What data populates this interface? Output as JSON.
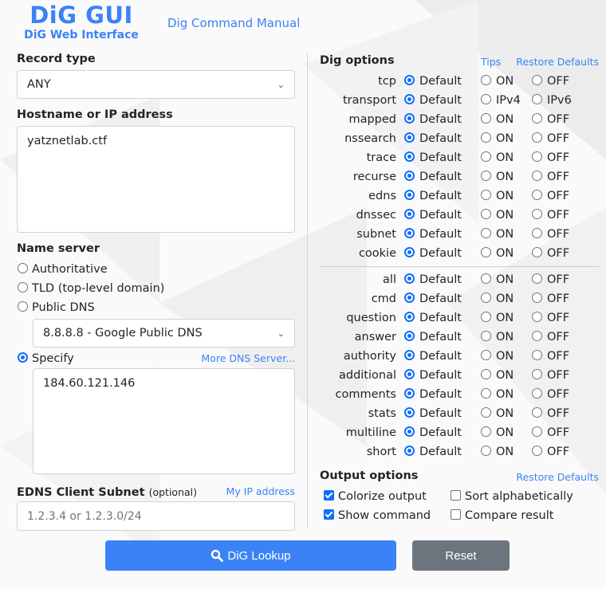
{
  "brand": {
    "title": "DiG GUI",
    "subtitle": "DiG Web Interface"
  },
  "header": {
    "manual_link": "Dig Command Manual"
  },
  "record_type": {
    "label": "Record type",
    "value": "ANY"
  },
  "hostname": {
    "label": "Hostname or IP address",
    "value": "yatznetlab.ctf"
  },
  "name_server": {
    "label": "Name server",
    "options": [
      {
        "label": "Authoritative",
        "checked": false
      },
      {
        "label": "TLD (top-level domain)",
        "checked": false
      },
      {
        "label": "Public DNS",
        "checked": false
      }
    ],
    "public_dns_value": "8.8.8.8 - Google Public DNS",
    "specify_label": "Specify",
    "specify_checked": true,
    "more_link": "More DNS Server...",
    "specify_value": "184.60.121.146"
  },
  "edns": {
    "label": "EDNS Client Subnet",
    "optional": "(optional)",
    "my_ip_link": "My IP address",
    "placeholder": "1.2.3.4 or 1.2.3.0/24"
  },
  "dig_options": {
    "label": "Dig options",
    "tips_link": "Tips",
    "restore_link": "Restore Defaults",
    "group1": [
      {
        "name": "tcp",
        "o1": "Default",
        "o2": "ON",
        "o3": "OFF"
      },
      {
        "name": "transport",
        "o1": "Default",
        "o2": "IPv4",
        "o3": "IPv6"
      },
      {
        "name": "mapped",
        "o1": "Default",
        "o2": "ON",
        "o3": "OFF"
      },
      {
        "name": "nssearch",
        "o1": "Default",
        "o2": "ON",
        "o3": "OFF"
      },
      {
        "name": "trace",
        "o1": "Default",
        "o2": "ON",
        "o3": "OFF"
      },
      {
        "name": "recurse",
        "o1": "Default",
        "o2": "ON",
        "o3": "OFF"
      },
      {
        "name": "edns",
        "o1": "Default",
        "o2": "ON",
        "o3": "OFF"
      },
      {
        "name": "dnssec",
        "o1": "Default",
        "o2": "ON",
        "o3": "OFF"
      },
      {
        "name": "subnet",
        "o1": "Default",
        "o2": "ON",
        "o3": "OFF"
      },
      {
        "name": "cookie",
        "o1": "Default",
        "o2": "ON",
        "o3": "OFF"
      }
    ],
    "group2": [
      {
        "name": "all",
        "o1": "Default",
        "o2": "ON",
        "o3": "OFF"
      },
      {
        "name": "cmd",
        "o1": "Default",
        "o2": "ON",
        "o3": "OFF"
      },
      {
        "name": "question",
        "o1": "Default",
        "o2": "ON",
        "o3": "OFF"
      },
      {
        "name": "answer",
        "o1": "Default",
        "o2": "ON",
        "o3": "OFF"
      },
      {
        "name": "authority",
        "o1": "Default",
        "o2": "ON",
        "o3": "OFF"
      },
      {
        "name": "additional",
        "o1": "Default",
        "o2": "ON",
        "o3": "OFF"
      },
      {
        "name": "comments",
        "o1": "Default",
        "o2": "ON",
        "o3": "OFF"
      },
      {
        "name": "stats",
        "o1": "Default",
        "o2": "ON",
        "o3": "OFF"
      },
      {
        "name": "multiline",
        "o1": "Default",
        "o2": "ON",
        "o3": "OFF"
      },
      {
        "name": "short",
        "o1": "Default",
        "o2": "ON",
        "o3": "OFF"
      }
    ]
  },
  "output_options": {
    "label": "Output options",
    "restore_link": "Restore Defaults",
    "colorize": {
      "label": "Colorize output",
      "checked": true
    },
    "sort": {
      "label": "Sort alphabetically",
      "checked": false
    },
    "show_command": {
      "label": "Show command",
      "checked": true
    },
    "compare": {
      "label": "Compare result",
      "checked": false
    }
  },
  "actions": {
    "lookup": "DiG Lookup",
    "reset": "Reset"
  },
  "colors": {
    "accent": "#3b82f6",
    "radio_checked": "#0d6efd",
    "secondary": "#6c757d"
  }
}
